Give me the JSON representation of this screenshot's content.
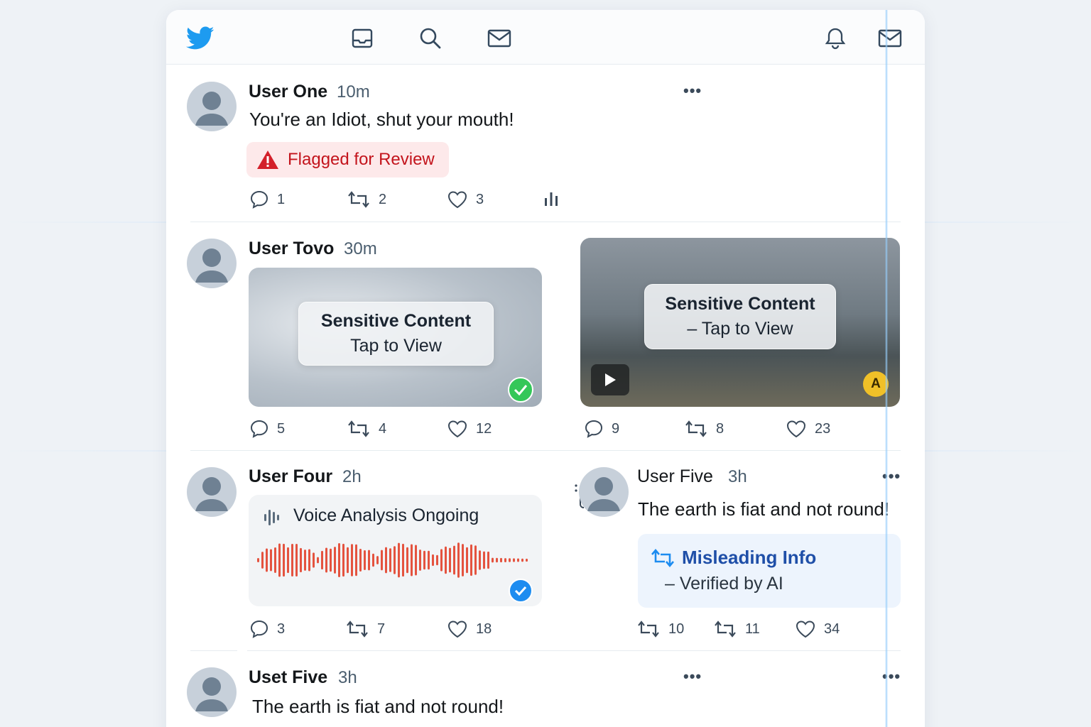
{
  "colors": {
    "brand": "#1d9bf0",
    "flag_text": "#c3141c",
    "misleading": "#1f4fa8",
    "wave": "#e4533f"
  },
  "top_nav": {
    "icons": [
      "twitter-logo-icon",
      "inbox-icon",
      "search-icon",
      "mail-icon",
      "bell-icon",
      "mail-icon"
    ]
  },
  "tweets": [
    {
      "user": "User One",
      "time": "10m",
      "text": "You're an Idiot, shut your mouth!",
      "flag": "Flagged for Review",
      "reply": "1",
      "retweet": "2",
      "like": "3"
    },
    {
      "user": "User Tovo",
      "time": "30m",
      "media_l1": "Sensitive Content",
      "media_l2": "Tap to View",
      "reply": "5",
      "retweet": "4",
      "like": "12"
    },
    {
      "media_l1": "Sensitive Content",
      "media_l2": "– Tap to View",
      "badge": "A",
      "reply": "9",
      "retweet": "8",
      "like": "23"
    },
    {
      "user": "User Four",
      "time": "2h",
      "voice_label": "Voice Analysis Ongoing",
      "reply": "3",
      "retweet": "7",
      "like": "18"
    },
    {
      "user": "User Five",
      "time": "3h",
      "text": "The earth is fiat and not round!",
      "notice_title": "Misleading Info",
      "notice_sub": "– Verified by AI",
      "reply": "10",
      "retweet": "11",
      "like": "34"
    },
    {
      "user": "Uset Five",
      "time": "3h",
      "text": "The earth is fiat and not round!"
    }
  ]
}
